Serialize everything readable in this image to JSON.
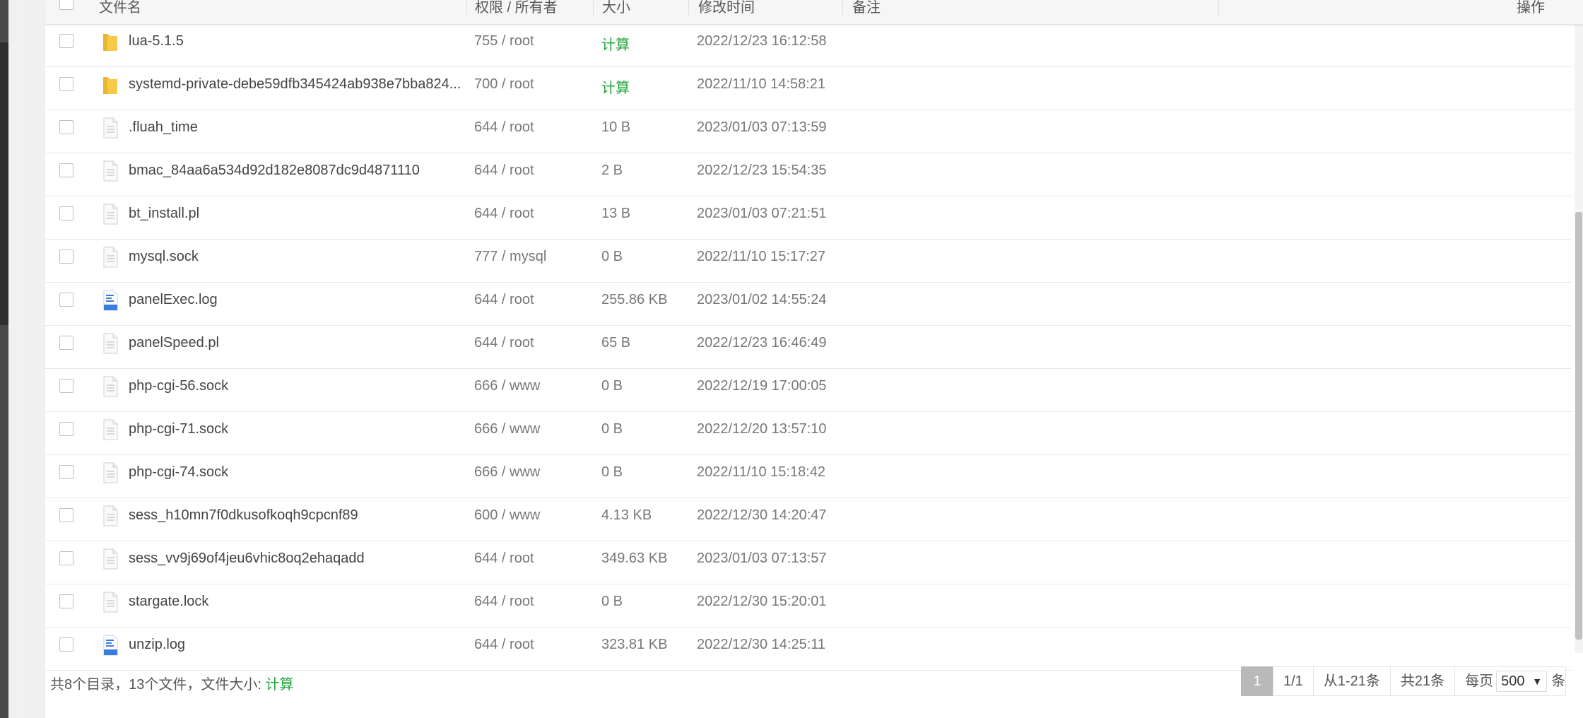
{
  "table": {
    "headers": {
      "name": "文件名",
      "perm": "权限 / 所有者",
      "size": "大小",
      "mtime": "修改时间",
      "remark": "备注",
      "ops": "操作"
    },
    "rows": [
      {
        "type": "folder",
        "name": "lua-5.1.5",
        "perm": "755 / root",
        "size": "计算",
        "mtime": "2022/12/23 16:12:58"
      },
      {
        "type": "folder",
        "name": "systemd-private-debe59dfb345424ab938e7bba824...",
        "perm": "700 / root",
        "size": "计算",
        "mtime": "2022/11/10 14:58:21"
      },
      {
        "type": "file",
        "name": ".fluah_time",
        "perm": "644 / root",
        "size": "10 B",
        "mtime": "2023/01/03 07:13:59"
      },
      {
        "type": "file",
        "name": "bmac_84aa6a534d92d182e8087dc9d4871110",
        "perm": "644 / root",
        "size": "2 B",
        "mtime": "2022/12/23 15:54:35"
      },
      {
        "type": "file",
        "name": "bt_install.pl",
        "perm": "644 / root",
        "size": "13 B",
        "mtime": "2023/01/03 07:21:51"
      },
      {
        "type": "file",
        "name": "mysql.sock",
        "perm": "777 / mysql",
        "size": "0 B",
        "mtime": "2022/11/10 15:17:27"
      },
      {
        "type": "log",
        "name": "panelExec.log",
        "perm": "644 / root",
        "size": "255.86 KB",
        "mtime": "2023/01/02 14:55:24"
      },
      {
        "type": "file",
        "name": "panelSpeed.pl",
        "perm": "644 / root",
        "size": "65 B",
        "mtime": "2022/12/23 16:46:49"
      },
      {
        "type": "file",
        "name": "php-cgi-56.sock",
        "perm": "666 / www",
        "size": "0 B",
        "mtime": "2022/12/19 17:00:05"
      },
      {
        "type": "file",
        "name": "php-cgi-71.sock",
        "perm": "666 / www",
        "size": "0 B",
        "mtime": "2022/12/20 13:57:10"
      },
      {
        "type": "file",
        "name": "php-cgi-74.sock",
        "perm": "666 / www",
        "size": "0 B",
        "mtime": "2022/11/10 15:18:42"
      },
      {
        "type": "file",
        "name": "sess_h10mn7f0dkusofkoqh9cpcnf89",
        "perm": "600 / www",
        "size": "4.13 KB",
        "mtime": "2022/12/30 14:20:47"
      },
      {
        "type": "file",
        "name": "sess_vv9j69of4jeu6vhic8oq2ehaqadd",
        "perm": "644 / root",
        "size": "349.63 KB",
        "mtime": "2023/01/03 07:13:57"
      },
      {
        "type": "file",
        "name": "stargate.lock",
        "perm": "644 / root",
        "size": "0 B",
        "mtime": "2022/12/30 15:20:01"
      },
      {
        "type": "log",
        "name": "unzip.log",
        "perm": "644 / root",
        "size": "323.81 KB",
        "mtime": "2022/12/30 14:25:11"
      }
    ]
  },
  "footer": {
    "summary": "共8个目录，13个文件，文件大小:",
    "calc_label": "计算"
  },
  "pager": {
    "current": "1",
    "pages": "1/1",
    "range": "从1-21条",
    "total": "共21条",
    "per_page_label": "每页",
    "per_page_value": "500",
    "unit": "条"
  },
  "colors": {
    "accent_green": "#20a53a",
    "folder_yellow": "#f7c948",
    "log_blue": "#3a7be0"
  }
}
